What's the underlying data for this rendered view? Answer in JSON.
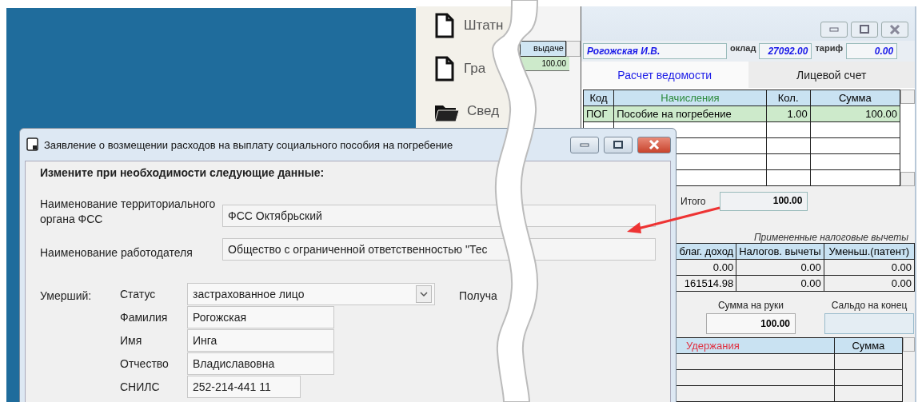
{
  "launcher": {
    "items": [
      {
        "label": "Штатн",
        "kind": "document"
      },
      {
        "label": "Гра",
        "kind": "document"
      },
      {
        "label": "Свед",
        "kind": "folder"
      }
    ]
  },
  "payroll_list": {
    "column": "выдаче",
    "rows": [
      "100.00"
    ]
  },
  "payroll_window": {
    "employee": "Рогожская И.В.",
    "salary_label": "оклад",
    "salary": "27092.00",
    "rate_label": "тариф",
    "rate": "0.00",
    "tabs": [
      {
        "label": "Расчет ведомости",
        "selected": true
      },
      {
        "label": "Лицевой счет",
        "selected": false
      }
    ],
    "accruals": {
      "columns": [
        "Код",
        "Начисления",
        "Кол.",
        "Сумма"
      ],
      "rows": [
        [
          "ПОГ",
          "Пособие на погребение",
          "1.00",
          "100.00"
        ]
      ]
    },
    "total_label": "Итого",
    "total": "100.00",
    "deductions_title": "Примененные налоговые вычеты",
    "tax": {
      "columns": [
        "благ. доход",
        "Налогов. вычеты",
        "Уменьш.(патент)"
      ],
      "rows": [
        [
          "0.00",
          "0.00",
          "0.00"
        ],
        [
          "161514.98",
          "0.00",
          "0.00"
        ]
      ]
    },
    "net_label": "Сумма на руки",
    "net": "100.00",
    "balance_label": "Сальдо на конец",
    "withholdings": {
      "columns": [
        "Удержания",
        "Сумма"
      ]
    }
  },
  "dialog": {
    "title": "Заявление о возмещении расходов на выплату социального пособия на погребение",
    "heading": "Измените при необходимости следующие данные:",
    "fields": [
      {
        "label": "Наименование территориального органа ФСС",
        "value": "ФСС Октябрьский"
      },
      {
        "label": "Наименование работодателя",
        "value": "Общество с ограниченной ответственностью \"Тес"
      }
    ],
    "deceased": {
      "label": "Умерший:",
      "fields": [
        {
          "label": "Статус",
          "value": "застрахованное лицо",
          "kind": "dropdown"
        },
        {
          "label": "Фамилия",
          "value": "Рогожская",
          "kind": "text"
        },
        {
          "label": "Имя",
          "value": "Инга",
          "kind": "text"
        },
        {
          "label": "Отчество",
          "value": "Владиславовна",
          "kind": "text"
        },
        {
          "label": "СНИЛС",
          "value": "252-214-441 11",
          "kind": "short"
        }
      ]
    },
    "recipient_label": "Получа"
  }
}
